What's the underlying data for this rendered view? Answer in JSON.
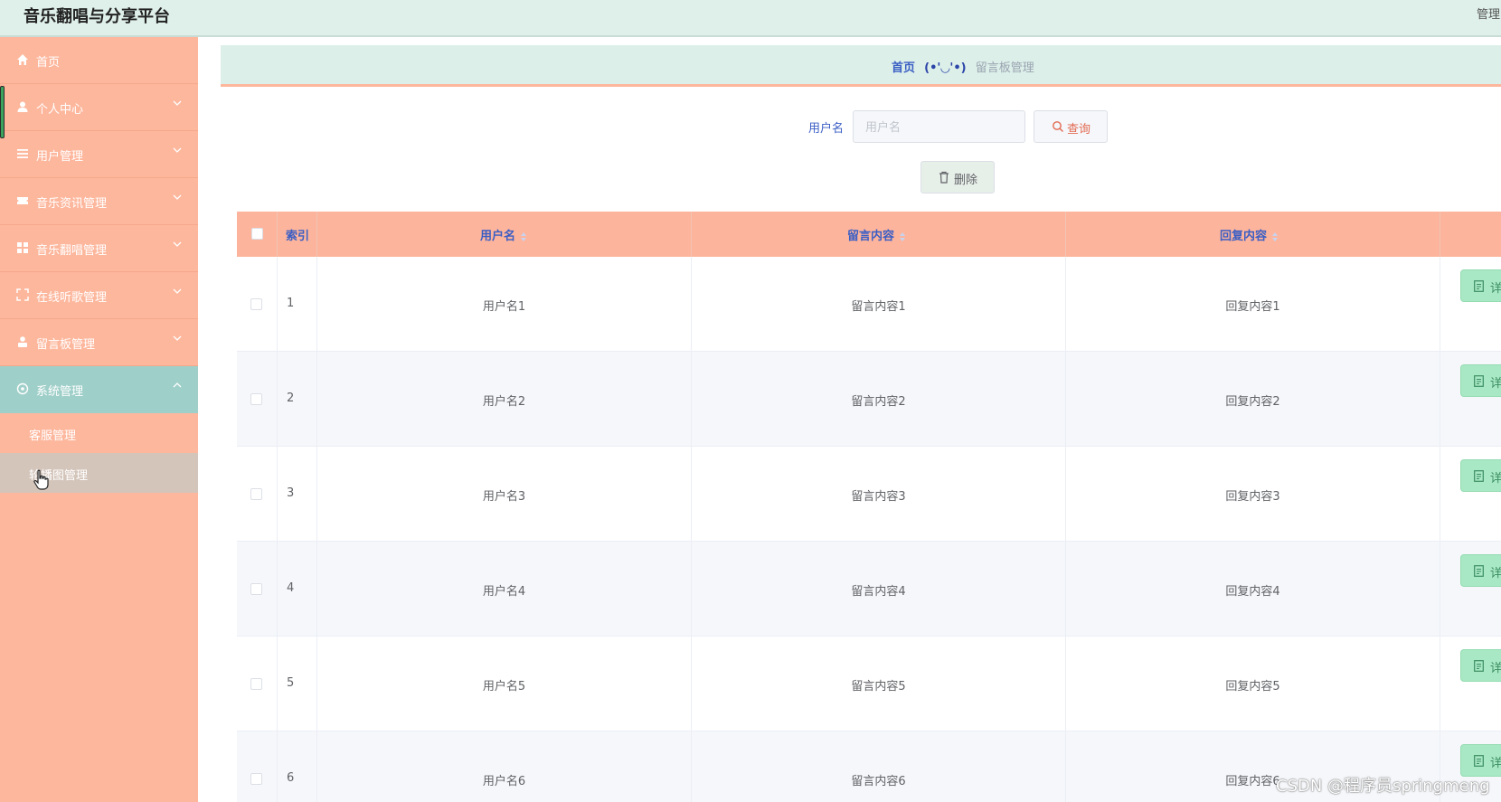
{
  "header": {
    "app_title": "音乐翻唱与分享平台",
    "admin_label": "管理"
  },
  "sidebar": {
    "items": [
      {
        "label": "首页",
        "icon": "home-icon"
      },
      {
        "label": "个人中心",
        "icon": "user-icon"
      },
      {
        "label": "用户管理",
        "icon": "list-icon"
      },
      {
        "label": "音乐资讯管理",
        "icon": "ticket-icon"
      },
      {
        "label": "音乐翻唱管理",
        "icon": "grid-icon"
      },
      {
        "label": "在线听歌管理",
        "icon": "fullscreen-icon"
      },
      {
        "label": "留言板管理",
        "icon": "person-icon"
      },
      {
        "label": "系统管理",
        "icon": "settings-icon"
      }
    ],
    "submenu": [
      {
        "label": "客服管理"
      },
      {
        "label": "轮播图管理"
      }
    ]
  },
  "breadcrumb": {
    "home": "首页",
    "emote": "(•'◡'•)",
    "current": "留言板管理"
  },
  "search": {
    "label": "用户名",
    "placeholder": "用户名",
    "button_label": "查询"
  },
  "toolbar": {
    "delete_label": "删除"
  },
  "table": {
    "columns": [
      "索引",
      "用户名",
      "留言内容",
      "回复内容"
    ],
    "action_label": "详",
    "rows": [
      {
        "index": "1",
        "username": "用户名1",
        "message": "留言内容1",
        "reply": "回复内容1"
      },
      {
        "index": "2",
        "username": "用户名2",
        "message": "留言内容2",
        "reply": "回复内容2"
      },
      {
        "index": "3",
        "username": "用户名3",
        "message": "留言内容3",
        "reply": "回复内容3"
      },
      {
        "index": "4",
        "username": "用户名4",
        "message": "留言内容4",
        "reply": "回复内容4"
      },
      {
        "index": "5",
        "username": "用户名5",
        "message": "留言内容5",
        "reply": "回复内容5"
      },
      {
        "index": "6",
        "username": "用户名6",
        "message": "留言内容6",
        "reply": "回复内容6"
      }
    ]
  },
  "watermark": "CSDN @程序员springmeng",
  "colors": {
    "sidebar_bg": "#fdb79d",
    "sidebar_active": "#9fcfc9",
    "header_bg": "#dff0ea",
    "table_header": "#fdb49c",
    "accent_blue": "#3a5ec4",
    "detail_green": "#a8e8c4",
    "query_red": "#e36b52"
  }
}
